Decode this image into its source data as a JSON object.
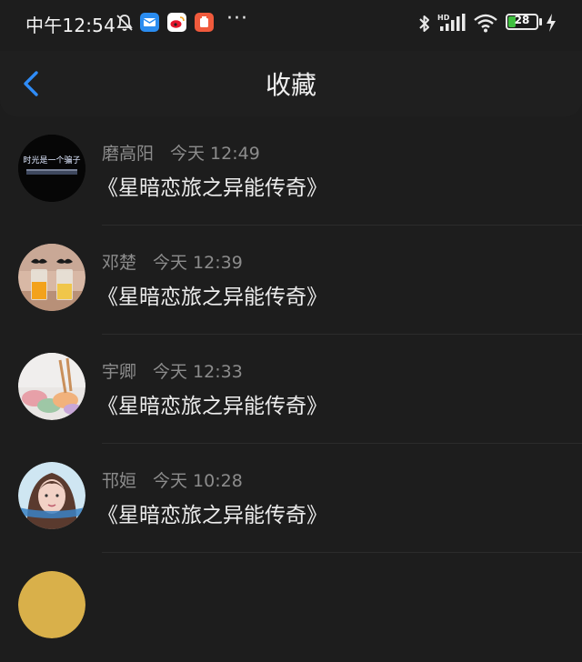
{
  "status_bar": {
    "time": "中午12:54",
    "more": "···",
    "battery": {
      "level": "28",
      "percent": 28
    },
    "colors": {
      "battery_green": "#3fbf3f",
      "weibo": "#e6162d",
      "mail": "#2a8cf0",
      "tool": "#f05a3c"
    }
  },
  "header": {
    "title": "收藏",
    "back_icon": "chevron-left",
    "accent": "#2f8cf7"
  },
  "items": [
    {
      "author": "磨高阳",
      "time": "今天 12:49",
      "title": "《星暗恋旅之异能传奇》",
      "avatar_text": "时光是一个骗子"
    },
    {
      "author": "邓楚",
      "time": "今天 12:39",
      "title": "《星暗恋旅之异能传奇》"
    },
    {
      "author": "宇卿",
      "time": "今天 12:33",
      "title": "《星暗恋旅之异能传奇》"
    },
    {
      "author": "邗姮",
      "time": "今天 10:28",
      "title": "《星暗恋旅之异能传奇》"
    }
  ]
}
